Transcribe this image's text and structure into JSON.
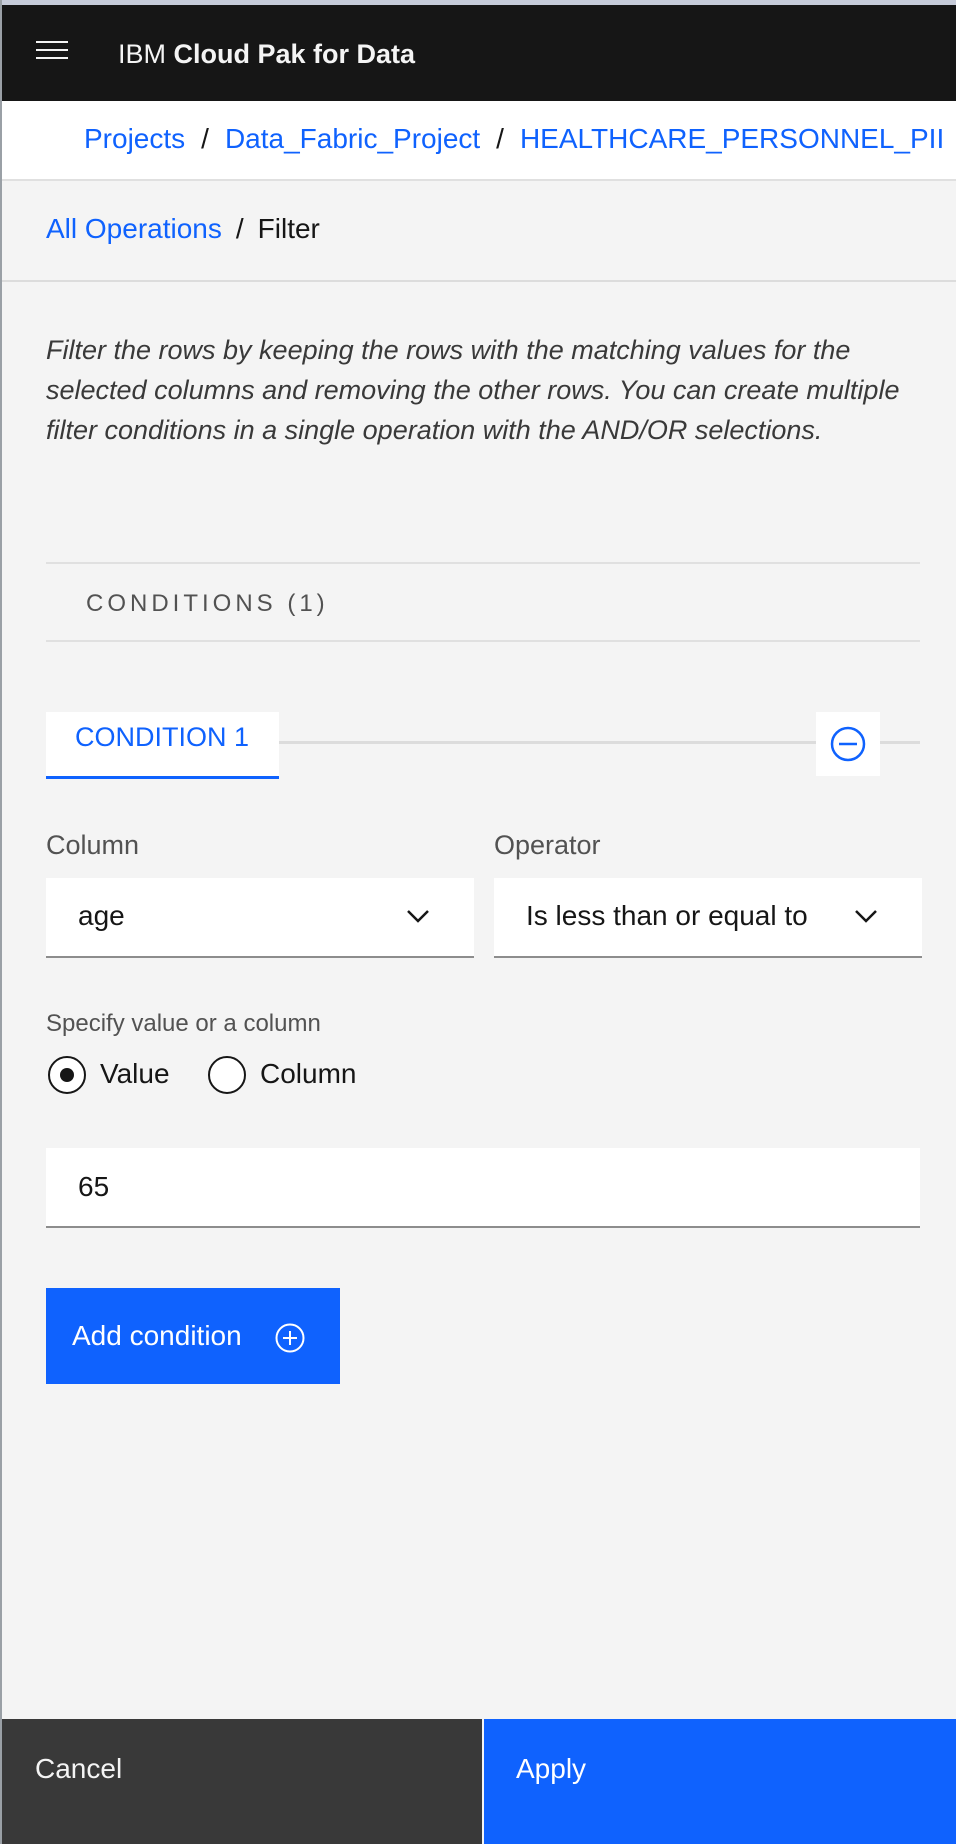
{
  "header": {
    "brand_prefix": "IBM",
    "brand_name": "Cloud Pak for Data"
  },
  "breadcrumb": {
    "items": [
      "Projects",
      "Data_Fabric_Project",
      "HEALTHCARE_PERSONNEL_PII"
    ],
    "separator": "/"
  },
  "operation_breadcrumb": {
    "parent": "All Operations",
    "current": "Filter",
    "separator": "/"
  },
  "description": "Filter the rows by keeping the rows with the matching values for the selected columns and removing the other rows. You can create multiple filter conditions in a single operation with the AND/OR selections.",
  "conditions": {
    "header": "CONDITIONS (1)",
    "tab_label": "CONDITION 1",
    "column_label": "Column",
    "column_value": "age",
    "operator_label": "Operator",
    "operator_value": "Is less than or equal to",
    "specify_label": "Specify value or a column",
    "radio_value_label": "Value",
    "radio_column_label": "Column",
    "selected_radio": "Value",
    "value": "65",
    "add_condition_label": "Add condition"
  },
  "footer": {
    "cancel_label": "Cancel",
    "apply_label": "Apply"
  },
  "colors": {
    "accent": "#0f62fe",
    "header_bg": "#161616",
    "cancel_bg": "#393939"
  }
}
